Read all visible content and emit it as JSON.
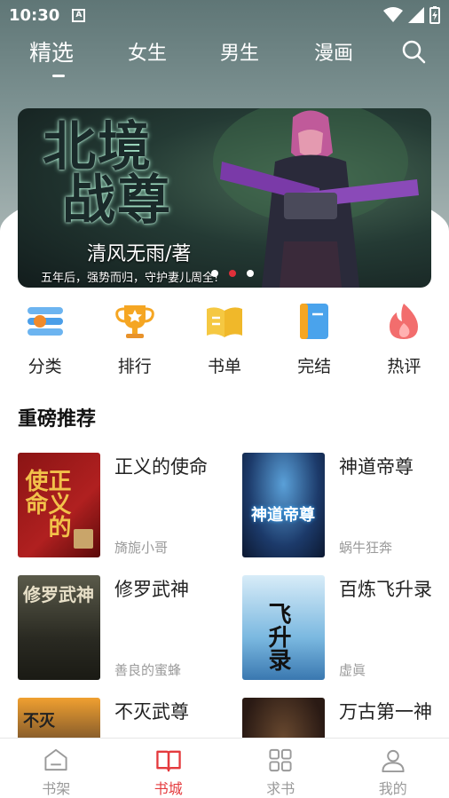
{
  "status": {
    "time": "10:30",
    "notice_icon": "A"
  },
  "tabs": [
    {
      "label": "精选",
      "active": true
    },
    {
      "label": "女生",
      "active": false
    },
    {
      "label": "男生",
      "active": false
    },
    {
      "label": "漫画",
      "active": false
    }
  ],
  "banner": {
    "title_line1": "北境",
    "title_line2": "战尊",
    "author": "清风无雨/著",
    "tagline": "五年后，强势而归，守护妻儿周全!",
    "slides": 3,
    "active_slide": 2
  },
  "quick_menu": [
    {
      "label": "分类",
      "icon": "category-icon"
    },
    {
      "label": "排行",
      "icon": "trophy-icon"
    },
    {
      "label": "书单",
      "icon": "book-list-icon"
    },
    {
      "label": "完结",
      "icon": "finished-book-icon"
    },
    {
      "label": "热评",
      "icon": "flame-icon"
    }
  ],
  "section": {
    "title": "重磅推荐"
  },
  "books": [
    {
      "title": "正义的使命",
      "author": "旖旎小哥",
      "cover_text": "正义的使命"
    },
    {
      "title": "神道帝尊",
      "author": "蜗牛狂奔",
      "cover_text": "神道帝尊"
    },
    {
      "title": "修罗武神",
      "author": "善良的蜜蜂",
      "cover_text": "修罗武神"
    },
    {
      "title": "百炼飞升录",
      "author": "虚眞",
      "cover_text": "飞升录"
    },
    {
      "title": "不灭武尊",
      "author": "",
      "cover_text": "不灭"
    },
    {
      "title": "万古第一神",
      "author": "",
      "cover_text": ""
    }
  ],
  "bottom_nav": [
    {
      "label": "书架",
      "icon": "bookshelf-icon",
      "active": false
    },
    {
      "label": "书城",
      "icon": "open-book-icon",
      "active": true
    },
    {
      "label": "求书",
      "icon": "grid-icon",
      "active": false
    },
    {
      "label": "我的",
      "icon": "user-icon",
      "active": false
    }
  ],
  "colors": {
    "accent": "#e43a3d",
    "header": "#6f8584"
  }
}
